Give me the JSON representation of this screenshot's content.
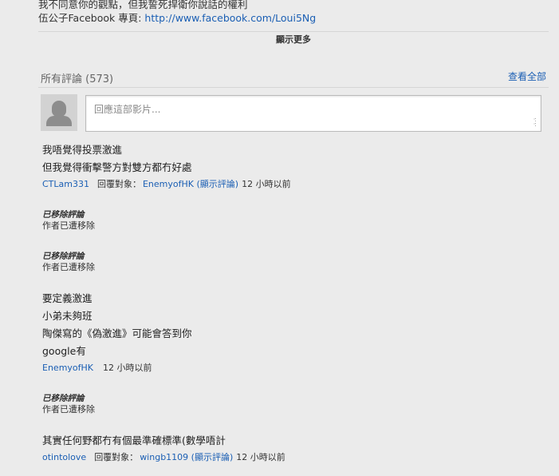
{
  "description": {
    "line1": "我不同意你的觀點，但我誓死捍衛你說話的權利",
    "line2_prefix": "伍公子Facebook 專頁: ",
    "line2_link": "http://www.facebook.com/Loui5Ng"
  },
  "show_more_label": "顯示更多",
  "comments_header": {
    "title": "所有評論",
    "count": "(573)",
    "view_all_label": "查看全部"
  },
  "reply_input": {
    "placeholder": "回應這部影片..."
  },
  "comments": [
    {
      "lines": [
        "我唔覺得投票激進",
        "但我覺得衝擊警方對雙方都冇好處"
      ],
      "author": "CTLam331",
      "reply_label": "回覆對象：",
      "reply_target": "EnemyofHK (顯示評論)",
      "time": "12 小時以前"
    },
    {
      "removed_title": "已移除評論",
      "removed_sub": "作者已遭移除"
    },
    {
      "removed_title": "已移除評論",
      "removed_sub": "作者已遭移除"
    },
    {
      "lines": [
        "要定義激進",
        "小弟未夠班",
        "陶傑寫的《偽激進》可能會答到你",
        "google有"
      ],
      "author": "EnemyofHK",
      "time": "12 小時以前"
    },
    {
      "removed_title": "已移除評論",
      "removed_sub": "作者已遭移除"
    },
    {
      "lines": [
        "其實任何野都冇有個最準確標準(數學唔計"
      ],
      "author": "otintolove",
      "reply_label": "回覆對象：",
      "reply_target": "wingb1109 (顯示評論)",
      "time": "12 小時以前"
    }
  ]
}
